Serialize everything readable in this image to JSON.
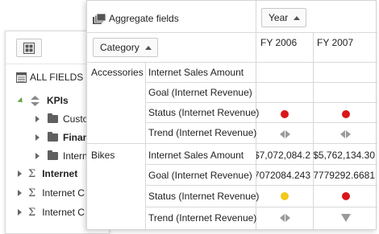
{
  "field_list": {
    "all_fields_label": "ALL FIELDS",
    "items": [
      {
        "label": "KPIs",
        "type": "kpi-group",
        "expanded": true,
        "bold": true
      },
      {
        "label": "Custo",
        "type": "folder",
        "expanded": false,
        "bold": false
      },
      {
        "label": "Finan",
        "type": "folder",
        "expanded": false,
        "bold": true
      },
      {
        "label": "Intern",
        "type": "folder",
        "expanded": false,
        "bold": false
      },
      {
        "label": "Internet",
        "type": "measure",
        "expanded": false,
        "bold": true
      },
      {
        "label": "Internet C",
        "type": "measure",
        "expanded": false,
        "bold": false
      },
      {
        "label": "Internet C",
        "type": "measure",
        "expanded": false,
        "bold": false
      }
    ]
  },
  "pivot": {
    "aggregate_label": "Aggregate fields",
    "column_field": "Year",
    "row_field": "Category",
    "columns": [
      "FY 2006",
      "FY 2007"
    ],
    "rows": [
      {
        "category": "Accessories",
        "measure": "Internet Sales Amount",
        "fy2006": "",
        "fy2007": ""
      },
      {
        "category": "",
        "measure": "Goal (Internet Revenue)",
        "fy2006": "",
        "fy2007": ""
      },
      {
        "category": "",
        "measure": "Status (Internet Revenue)",
        "fy2006": "red-dot",
        "fy2007": "red-dot"
      },
      {
        "category": "",
        "measure": "Trend (Internet Revenue)",
        "fy2006": "flat-arrows",
        "fy2007": "flat-arrows"
      },
      {
        "category": "Bikes",
        "measure": "Internet Sales Amount",
        "fy2006": "$7,072,084.2",
        "fy2007": "$5,762,134.30"
      },
      {
        "category": "",
        "measure": "Goal (Internet Revenue)",
        "fy2006": "7072084.243",
        "fy2007": "7779292.6681"
      },
      {
        "category": "",
        "measure": "Status (Internet Revenue)",
        "fy2006": "yellow-dot",
        "fy2007": "red-dot"
      },
      {
        "category": "",
        "measure": "Trend (Internet Revenue)",
        "fy2006": "flat-arrows",
        "fy2007": "down-arrow"
      }
    ]
  },
  "colors": {
    "status_red": "#d9161a",
    "status_yellow": "#f2c81a",
    "kpi_green": "#6aa84f",
    "border": "#d9d9d9"
  },
  "icons": {
    "layout": "grid-layout-icon",
    "all_fields": "field-list-icon",
    "aggregate": "aggregate-fields-icon",
    "folder": "folder-icon",
    "measure": "sigma-icon",
    "kpi": "kpi-icon"
  }
}
